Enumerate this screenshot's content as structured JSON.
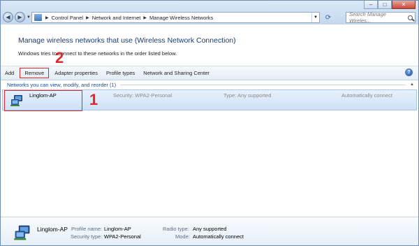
{
  "window": {
    "controls": {
      "minimize": "–",
      "maximize": "□",
      "close": "✕"
    }
  },
  "address": {
    "crumbs": [
      "Control Panel",
      "Network and Internet",
      "Manage Wireless Networks"
    ],
    "search_placeholder": "Search Manage Wireles..."
  },
  "header": {
    "title": "Manage wireless networks that use (Wireless Network Connection)",
    "description": "Windows tries to connect to these networks in the order listed below."
  },
  "toolbar": {
    "add": "Add",
    "remove": "Remove",
    "adapter_properties": "Adapter properties",
    "profile_types": "Profile types",
    "sharing_center": "Network and Sharing Center",
    "help": "?"
  },
  "group": {
    "label": "Networks you can view, modify, and reorder (1)"
  },
  "networks": [
    {
      "name": "Linglom-AP",
      "security": "Security:  WPA2-Personal",
      "type": "Type:  Any supported",
      "connection": "Automatically connect"
    }
  ],
  "annotations": {
    "step1": "1",
    "step2": "2",
    "color": "#d9292b"
  },
  "details": {
    "name": "Linglom-AP",
    "profile_name_label": "Profile name:",
    "profile_name": "Linglom-AP",
    "security_type_label": "Security type:",
    "security_type": "WPA2-Personal",
    "radio_type_label": "Radio type:",
    "radio_type": "Any supported",
    "mode_label": "Mode:",
    "mode": "Automatically connect"
  }
}
